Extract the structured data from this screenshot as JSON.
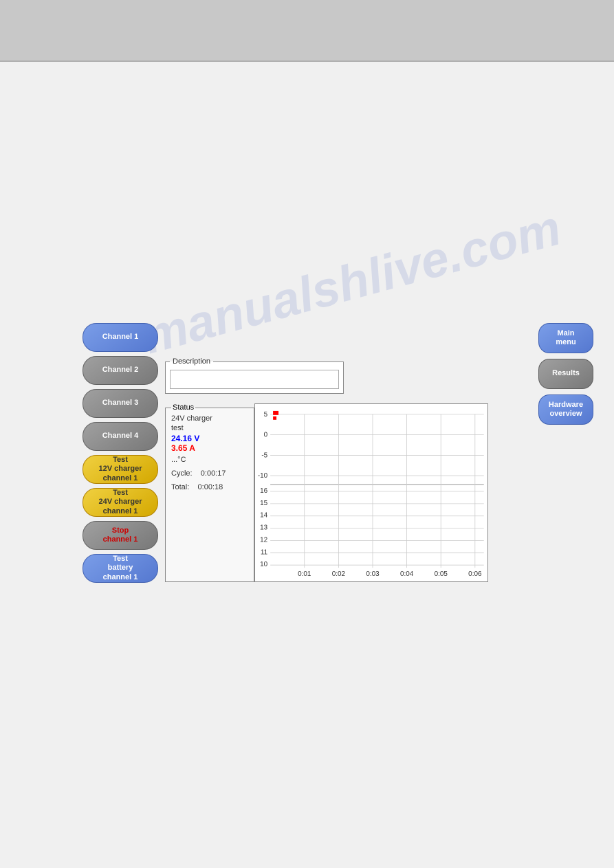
{
  "watermark": "manualshlive.com",
  "topBar": {},
  "leftPanel": {
    "buttons": [
      {
        "id": "channel1",
        "label": "Channel 1",
        "style": "blue"
      },
      {
        "id": "channel2",
        "label": "Channel 2",
        "style": "gray"
      },
      {
        "id": "channel3",
        "label": "Channel 3",
        "style": "gray"
      },
      {
        "id": "channel4",
        "label": "Channel 4",
        "style": "gray"
      },
      {
        "id": "test12v",
        "label": "Test\n12V charger\nchannel 1",
        "style": "yellow"
      },
      {
        "id": "test24v",
        "label": "Test\n24V charger\nchannel 1",
        "style": "yellow"
      },
      {
        "id": "stop",
        "label": "Stop\nchannel 1",
        "style": "stop"
      },
      {
        "id": "testbattery",
        "label": "Test\nbattery\nchannel 1",
        "style": "blue"
      }
    ]
  },
  "rightPanel": {
    "buttons": [
      {
        "id": "mainmenu",
        "label": "Main\nmenu",
        "style": "blue"
      },
      {
        "id": "results",
        "label": "Results",
        "style": "gray"
      },
      {
        "id": "hardwareoverview",
        "label": "Hardware\noverview",
        "style": "blue"
      }
    ]
  },
  "description": {
    "legend": "Description",
    "value": ""
  },
  "status": {
    "legend": "Status",
    "line1": "24V charger",
    "line2": "test",
    "voltage": "24.16 V",
    "current": "3.65 A",
    "temp": "...°C",
    "cycle_label": "Cycle:",
    "cycle_value": "0:00:17",
    "total_label": "Total:",
    "total_value": "0:00:18"
  },
  "chart": {
    "yAxis": {
      "top_labels": [
        "5",
        "0",
        "-5",
        "-10"
      ],
      "bottom_labels": [
        "16",
        "15",
        "14",
        "13",
        "12",
        "11",
        "10"
      ]
    },
    "xAxis": {
      "labels": [
        "0:01",
        "0:02",
        "0:03",
        "0:04",
        "0:05",
        "0:06"
      ]
    }
  }
}
